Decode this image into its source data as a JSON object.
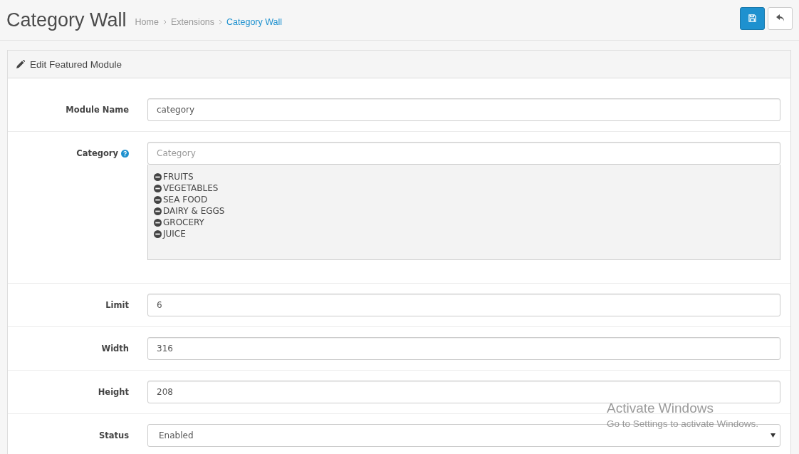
{
  "page": {
    "title": "Category Wall",
    "breadcrumbs": [
      {
        "label": "Home",
        "selected": false
      },
      {
        "label": "Extensions",
        "selected": false
      },
      {
        "label": "Category Wall",
        "selected": true
      }
    ]
  },
  "header_buttons": [
    {
      "kind": "save"
    },
    {
      "kind": "back"
    }
  ],
  "panel": {
    "title": "Edit Featured Module",
    "fields": [
      {
        "kind": "text",
        "label": "Module Name",
        "value": "category"
      },
      {
        "kind": "autocomplete",
        "label": "Category",
        "help": true,
        "placeholder": "Category",
        "items": [
          "FRUITS",
          "VEGETABLES",
          "SEA FOOD",
          "DAIRY & EGGS",
          "GROCERY",
          "JUICE"
        ]
      },
      {
        "kind": "text",
        "label": "Limit",
        "value": "6"
      },
      {
        "kind": "text",
        "label": "Width",
        "value": "316"
      },
      {
        "kind": "text",
        "label": "Height",
        "value": "208"
      },
      {
        "kind": "select",
        "label": "Status",
        "value": "Enabled"
      }
    ]
  },
  "overlay": {
    "title": "Activate Windows",
    "subtitle": "Go to Settings to activate Windows."
  }
}
